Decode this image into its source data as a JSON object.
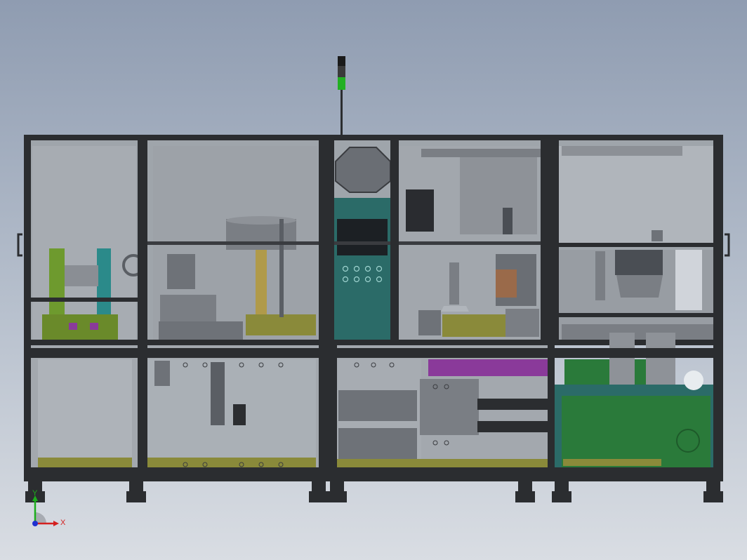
{
  "axis_triad": {
    "x_label": "X",
    "y_label": "Y",
    "x_color": "#d42020",
    "y_color": "#1cae1c",
    "z_color": "#2030d0"
  },
  "colors": {
    "background_top": "#8f9cb1",
    "background_bottom": "#d9dde3",
    "frame": "#2b2d30",
    "panel_glass": "#a4a9af",
    "teal_panel": "#2b6b68",
    "green_base": "#2a7a3a",
    "olive_plate": "#8a8a3a",
    "purple_block": "#8a3a9a",
    "signal_green": "#22b022",
    "signal_black": "#1a1a1a"
  },
  "icons": {
    "signal_tower": "signal-tower-icon",
    "leveling_foot": "leveling-foot-icon",
    "handle": "door-handle-icon",
    "coordinate_triad": "coordinate-triad-icon"
  }
}
